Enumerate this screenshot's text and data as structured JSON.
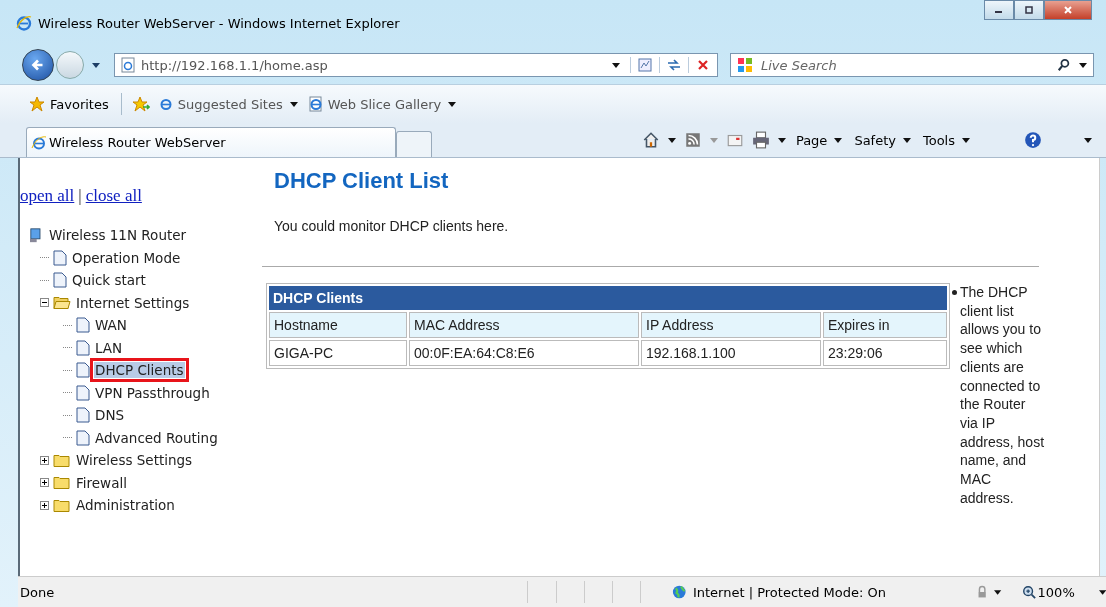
{
  "window": {
    "title": "Wireless Router WebServer - Windows Internet Explorer"
  },
  "address_bar": {
    "value": "http://192.168.1.1/home.asp"
  },
  "search": {
    "placeholder": "Live Search"
  },
  "favorites_bar": {
    "favorites": "Favorites",
    "links": [
      "Suggested Sites",
      "Web Slice Gallery"
    ]
  },
  "tabs": [
    {
      "label": "Wireless Router WebServer",
      "selected": true
    }
  ],
  "command_bar": [
    "Page",
    "Safety",
    "Tools"
  ],
  "sidebar": {
    "links": [
      "open all",
      "close all"
    ],
    "separator": "|",
    "tree": {
      "label": "Wireless 11N Router",
      "children": [
        {
          "kind": "page",
          "label": "Operation Mode",
          "selected": false
        },
        {
          "kind": "page",
          "label": "Quick start",
          "selected": false
        },
        {
          "kind": "folder",
          "label": "Internet Settings",
          "expanded": true,
          "children": [
            {
              "kind": "page",
              "label": "WAN",
              "selected": false
            },
            {
              "kind": "page",
              "label": "LAN",
              "selected": false
            },
            {
              "kind": "page",
              "label": "DHCP Clients",
              "selected": true
            },
            {
              "kind": "page",
              "label": "VPN Passthrough",
              "selected": false
            },
            {
              "kind": "page",
              "label": "DNS",
              "selected": false
            },
            {
              "kind": "page",
              "label": "Advanced Routing",
              "selected": false
            }
          ]
        },
        {
          "kind": "folder",
          "label": "Wireless Settings",
          "expanded": false
        },
        {
          "kind": "folder",
          "label": "Firewall",
          "expanded": false
        },
        {
          "kind": "folder",
          "label": "Administration",
          "expanded": false
        }
      ]
    }
  },
  "page": {
    "title": "DHCP Client List",
    "description": "You could monitor DHCP clients here.",
    "table": {
      "caption": "DHCP Clients",
      "columns": [
        "Hostname",
        "MAC Address",
        "IP Address",
        "Expires in"
      ],
      "rows": [
        [
          "GIGA-PC",
          "00:0F:EA:64:C8:E6",
          "192.168.1.100",
          "23:29:06"
        ]
      ]
    },
    "help": "The DHCP client list allows you to see which clients are connected to the Router via IP address, host name, and MAC address."
  },
  "status_bar": {
    "status": "Done",
    "zone": "Internet | Protected Mode: On",
    "zoom": "100%"
  }
}
